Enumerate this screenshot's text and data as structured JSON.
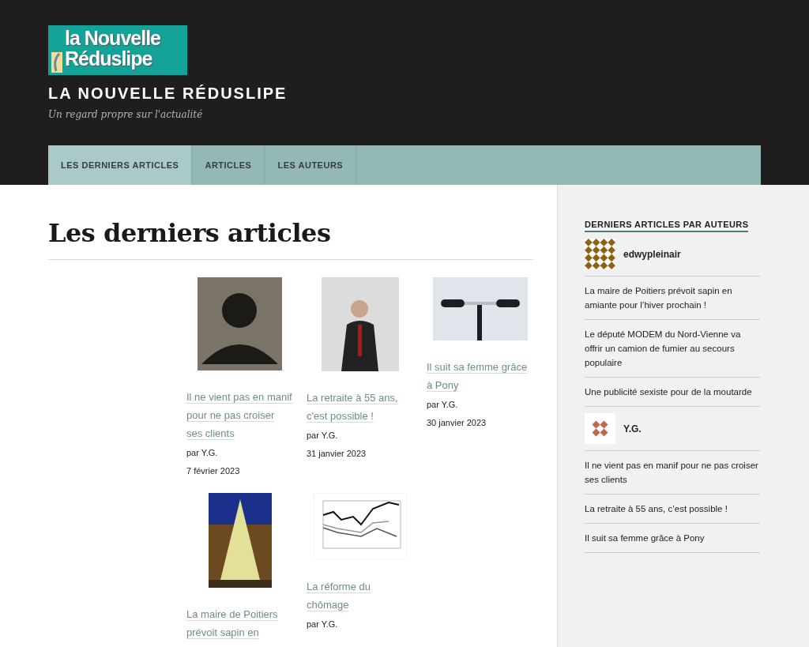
{
  "header": {
    "logo": {
      "line_1": "la Nouvelle",
      "line_2": "Réduslipe"
    },
    "site_title": "LA NOUVELLE RÉDUSLIPE",
    "tagline": "Un regard propre sur l'actualité"
  },
  "nav": [
    {
      "label": "LES DERNIERS ARTICLES",
      "selected": true
    },
    {
      "label": "ARTICLES",
      "selected": false
    },
    {
      "label": "LES AUTEURS",
      "selected": false
    }
  ],
  "main": {
    "title": "Les derniers articles",
    "articles": [
      {
        "kind": "portrait",
        "title": "Il ne vient pas en manif pour ne pas croiser ses clients",
        "author": "par Y.G.",
        "date": "7 février 2023"
      },
      {
        "kind": "dancer",
        "title": "La retraite à 55 ans, c'est possible !",
        "author": "par Y.G.",
        "date": "31 janvier 2023"
      },
      {
        "kind": "scooter",
        "title": "Il suit sa femme grâce à Pony",
        "author": "par Y.G.",
        "date": "30 janvier 2023"
      },
      {
        "kind": "tree",
        "title": "La maire de Poitiers prévoit sapin en"
      },
      {
        "kind": "chart",
        "title": "La réforme du chômage",
        "author": "par Y.G."
      }
    ]
  },
  "sidebar": {
    "heading": "DERNIERS ARTICLES PAR AUTEURS",
    "authors": [
      {
        "name": "edwypleinair",
        "color": "#8a6414",
        "posts": [
          "La maire de Poitiers prévoit sapin en amiante pour l’hiver prochain !",
          "Le député MODEM du Nord-Vienne va offrir un camion de fumier au secours populaire",
          "Une publicité sexiste pour de la moutarde"
        ]
      },
      {
        "name": "Y.G.",
        "color": "#c2674a",
        "posts": [
          "Il ne vient pas en manif pour ne pas croiser ses clients",
          "La retraite à 55 ans, c’est possible !",
          "Il suit sa femme grâce à Pony"
        ]
      }
    ]
  }
}
